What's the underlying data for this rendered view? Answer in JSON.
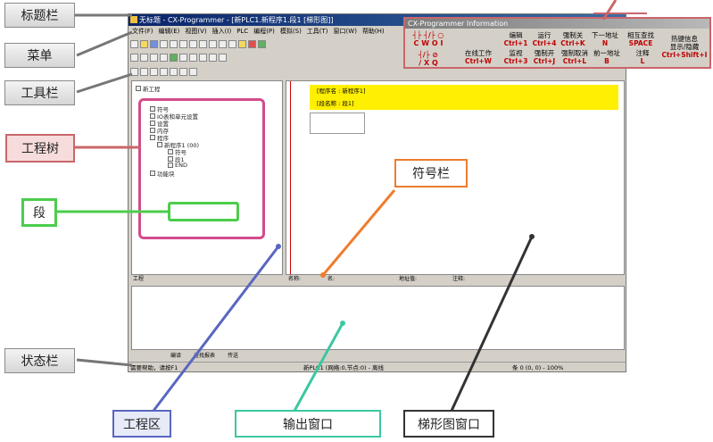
{
  "callouts": {
    "title_bar": "标题栏",
    "menu": "菜单",
    "toolbar": "工具栏",
    "project_tree": "工程树",
    "section": "段",
    "symbol_bar": "符号栏",
    "status_bar": "状态栏",
    "project_area": "工程区",
    "output_window": "输出窗口",
    "ladder_window": "梯形图窗口"
  },
  "colors": {
    "pink": "#c9666a",
    "green": "#4ccd4c",
    "orange": "#ef7c2e",
    "blue": "#5a66c0",
    "teal": "#3cc7a0",
    "black": "#333333",
    "ladder_header": "#ffef00"
  },
  "app": {
    "title": "无标题 - CX-Programmer - [新PLC1.新程序1.段1 [梯形图]]",
    "menu": [
      "文件(F)",
      "编辑(E)",
      "视图(V)",
      "插入(I)",
      "PLC",
      "编程(P)",
      "模拟(S)",
      "工具(T)",
      "窗口(W)",
      "帮助(H)"
    ],
    "tree": {
      "root": "新工程",
      "items": [
        "符号",
        "IO表和单元设置",
        "设置",
        "内存",
        "程序"
      ],
      "program": "新程序1 (00)",
      "program_children": [
        "符号",
        "段1",
        "END"
      ],
      "function_blocks": "功能块"
    },
    "ladder": {
      "program_name_label": "[程序名 : 新程序1]",
      "section_name_label": "[段名称 : 段1]"
    },
    "tabs": {
      "project_tab": "工程",
      "symbol_cols": [
        "名称:",
        "名:",
        "地址值:",
        "注释:"
      ],
      "output_tabs": [
        "编译",
        "查找报表",
        "传送"
      ]
    },
    "status": {
      "help": "需要帮助，请按F1",
      "plc": "新PLC1 (网络:0,节点:0) - 离线",
      "rung": "条 0 (0, 0) - 100%"
    }
  },
  "info_panel": {
    "title": "CX-Programmer Information",
    "cells": [
      {
        "label": "编辑",
        "key": "Ctrl+1"
      },
      {
        "label": "运行",
        "key": "Ctrl+4"
      },
      {
        "label": "强制关",
        "key": "Ctrl+K"
      },
      {
        "label": "下一地址",
        "key": "N"
      },
      {
        "label": "相互查找",
        "key": "SPACE"
      },
      {
        "label": "热键信息",
        "key": "显示/隐藏"
      },
      {
        "label": "在线工作",
        "key": "Ctrl+W"
      },
      {
        "label": "监视",
        "key": "Ctrl+3"
      },
      {
        "label": "强制开",
        "key": "Ctrl+J"
      },
      {
        "label": "强制取消",
        "key": "Ctrl+L"
      },
      {
        "label": "前一地址",
        "key": "B"
      },
      {
        "label": "注释",
        "key": "L"
      },
      {
        "label": "",
        "key": "Ctrl+Shift+I"
      }
    ],
    "contact_keys": [
      "C",
      "W",
      "O",
      "I",
      "/",
      "X",
      "Q"
    ]
  }
}
